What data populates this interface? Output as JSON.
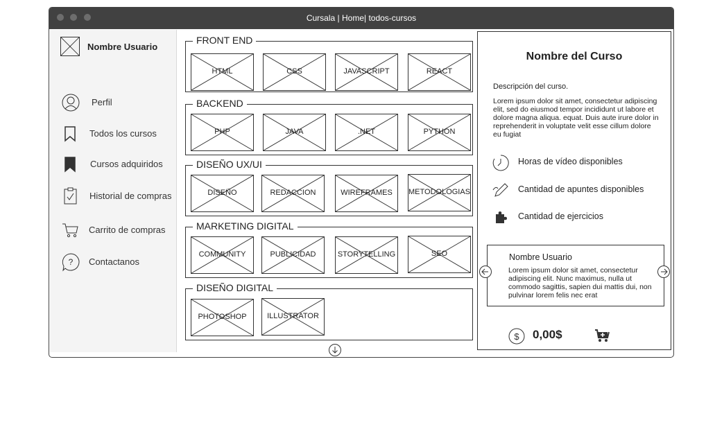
{
  "window": {
    "title": "Cursala | Home| todos-cursos"
  },
  "sidebar": {
    "user_name": "Nombre Usuario",
    "items": [
      {
        "label": "Perfil",
        "icon": "user-icon"
      },
      {
        "label": "Todos los cursos",
        "icon": "bookmark-outline-icon"
      },
      {
        "label": "Cursos adquiridos",
        "icon": "bookmark-filled-icon"
      },
      {
        "label": "Historial de compras",
        "icon": "clipboard-check-icon"
      },
      {
        "label": "Carrito de compras",
        "icon": "cart-icon"
      },
      {
        "label": "Contactanos",
        "icon": "help-bubble-icon"
      }
    ]
  },
  "categories": [
    {
      "title": "FRONT END",
      "courses": [
        "HTML",
        "CSS",
        "JAVASCRIPT",
        "REACT"
      ]
    },
    {
      "title": "BACKEND",
      "courses": [
        "PHP",
        "JAVA",
        ".NET",
        "PYTHON"
      ]
    },
    {
      "title": "DISEÑO UX/UI",
      "courses": [
        "DISEÑO",
        "REDACCION",
        "WIREFRAMES",
        "METODOLOGIAS"
      ]
    },
    {
      "title": "MARKETING DIGITAL",
      "courses": [
        "COMMUNITY",
        "PUBLICIDAD",
        "STORYTELLING",
        "SEO"
      ]
    },
    {
      "title": "DISEÑO DIGITAL",
      "courses": [
        "PHOTOSHOP",
        "ILLUSTRATOR"
      ]
    }
  ],
  "detail": {
    "course_title": "Nombre del Curso",
    "description_label": "Descripción del curso.",
    "description": "Lorem ipsum dolor sit amet, consectetur adipiscing elit, sed do eiusmod tempor incididunt ut labore et dolore magna aliqua. equat. Duis aute irure dolor in reprehenderit in voluptate velit esse cillum dolore eu fugiat",
    "features": [
      {
        "label": "Horas de vídeo disponibles",
        "icon": "clock-icon"
      },
      {
        "label": "Cantidad de apuntes disponibles",
        "icon": "pencil-icon"
      },
      {
        "label": "Cantidad de ejercicios",
        "icon": "puzzle-icon"
      }
    ],
    "review": {
      "user": "Nombre Usuario",
      "text": "Lorem ipsum dolor sit amet, consectetur adipiscing elit. Nunc maximus, nulla ut commodo sagittis, sapien dui mattis dui, non pulvinar lorem felis nec erat"
    },
    "price": "0,00$"
  },
  "colors": {
    "titlebar": "#414141",
    "sidebar_bg": "#f4f4f4",
    "stroke": "#333333"
  }
}
